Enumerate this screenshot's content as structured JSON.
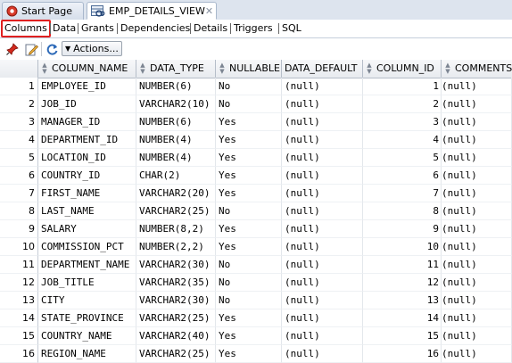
{
  "editor_tabs": {
    "start_page": "Start Page",
    "view_tab": "EMP_DETAILS_VIEW"
  },
  "sub_tabs": [
    "Columns",
    "Data",
    "Grants",
    "Dependencies",
    "Details",
    "Triggers",
    "SQL"
  ],
  "toolbar": {
    "actions_label": "Actions..."
  },
  "grid": {
    "headers": [
      "COLUMN_NAME",
      "DATA_TYPE",
      "NULLABLE",
      "DATA_DEFAULT",
      "COLUMN_ID",
      "COMMENTS"
    ],
    "rows": [
      {
        "n": "1",
        "name": "EMPLOYEE_ID",
        "type": "NUMBER(6)",
        "nullable": "No",
        "default": "(null)",
        "id": "1",
        "comments": "(null)"
      },
      {
        "n": "2",
        "name": "JOB_ID",
        "type": "VARCHAR2(10)",
        "nullable": "No",
        "default": "(null)",
        "id": "2",
        "comments": "(null)"
      },
      {
        "n": "3",
        "name": "MANAGER_ID",
        "type": "NUMBER(6)",
        "nullable": "Yes",
        "default": "(null)",
        "id": "3",
        "comments": "(null)"
      },
      {
        "n": "4",
        "name": "DEPARTMENT_ID",
        "type": "NUMBER(4)",
        "nullable": "Yes",
        "default": "(null)",
        "id": "4",
        "comments": "(null)"
      },
      {
        "n": "5",
        "name": "LOCATION_ID",
        "type": "NUMBER(4)",
        "nullable": "Yes",
        "default": "(null)",
        "id": "5",
        "comments": "(null)"
      },
      {
        "n": "6",
        "name": "COUNTRY_ID",
        "type": "CHAR(2)",
        "nullable": "Yes",
        "default": "(null)",
        "id": "6",
        "comments": "(null)"
      },
      {
        "n": "7",
        "name": "FIRST_NAME",
        "type": "VARCHAR2(20)",
        "nullable": "Yes",
        "default": "(null)",
        "id": "7",
        "comments": "(null)"
      },
      {
        "n": "8",
        "name": "LAST_NAME",
        "type": "VARCHAR2(25)",
        "nullable": "No",
        "default": "(null)",
        "id": "8",
        "comments": "(null)"
      },
      {
        "n": "9",
        "name": "SALARY",
        "type": "NUMBER(8,2)",
        "nullable": "Yes",
        "default": "(null)",
        "id": "9",
        "comments": "(null)"
      },
      {
        "n": "10",
        "name": "COMMISSION_PCT",
        "type": "NUMBER(2,2)",
        "nullable": "Yes",
        "default": "(null)",
        "id": "10",
        "comments": "(null)"
      },
      {
        "n": "11",
        "name": "DEPARTMENT_NAME",
        "type": "VARCHAR2(30)",
        "nullable": "No",
        "default": "(null)",
        "id": "11",
        "comments": "(null)"
      },
      {
        "n": "12",
        "name": "JOB_TITLE",
        "type": "VARCHAR2(35)",
        "nullable": "No",
        "default": "(null)",
        "id": "12",
        "comments": "(null)"
      },
      {
        "n": "13",
        "name": "CITY",
        "type": "VARCHAR2(30)",
        "nullable": "No",
        "default": "(null)",
        "id": "13",
        "comments": "(null)"
      },
      {
        "n": "14",
        "name": "STATE_PROVINCE",
        "type": "VARCHAR2(25)",
        "nullable": "Yes",
        "default": "(null)",
        "id": "14",
        "comments": "(null)"
      },
      {
        "n": "15",
        "name": "COUNTRY_NAME",
        "type": "VARCHAR2(40)",
        "nullable": "Yes",
        "default": "(null)",
        "id": "15",
        "comments": "(null)"
      },
      {
        "n": "16",
        "name": "REGION_NAME",
        "type": "VARCHAR2(25)",
        "nullable": "Yes",
        "default": "(null)",
        "id": "16",
        "comments": "(null)"
      }
    ]
  },
  "colors": {
    "active_tab_highlight": "#e02020",
    "tab_bar_bg": "#dde4ee"
  }
}
